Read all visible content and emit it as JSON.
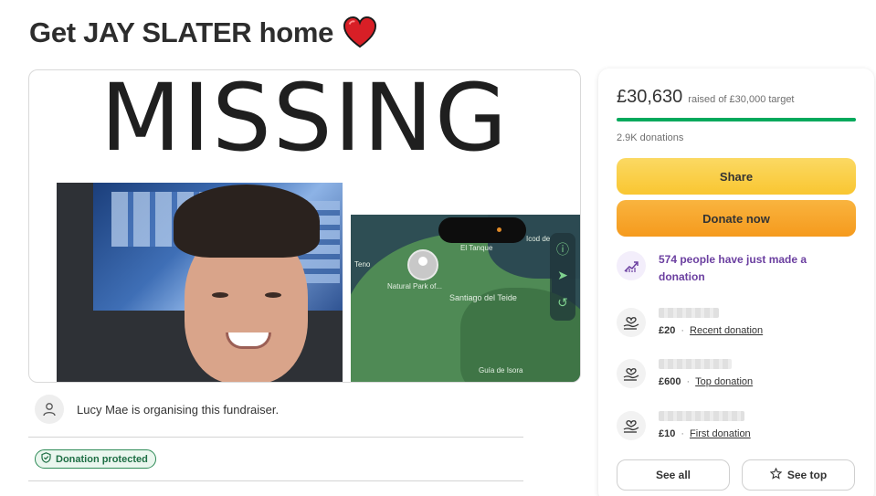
{
  "page": {
    "title": "Get JAY SLATER home"
  },
  "hero": {
    "headline": "MISSING",
    "map_labels": {
      "el_tanque": "El Tanque",
      "teno": "Teno",
      "natural_park": "Natural Park of...",
      "santiago": "Santiago del Teide",
      "guia": "Guía de Isora",
      "icod": "Icod de"
    }
  },
  "organiser": {
    "text": "Lucy Mae is organising this fundraiser."
  },
  "badge": {
    "label": "Donation protected"
  },
  "card": {
    "amount": "£30,630",
    "target_text": "raised of £30,000 target",
    "progress_fraction": 1.0,
    "donations": "2.9K donations",
    "share_label": "Share",
    "donate_label": "Donate now",
    "recent_people": "574 people have just made a donation",
    "donors": [
      {
        "amount": "£20",
        "type": "Recent donation"
      },
      {
        "amount": "£600",
        "type": "Top donation"
      },
      {
        "amount": "£10",
        "type": "First donation"
      }
    ],
    "see_all_label": "See all",
    "see_top_label": "See top"
  },
  "colors": {
    "progress": "#02a95c",
    "share": "#f9c631",
    "donate": "#f59a1d",
    "accent_purple": "#6b3fa0"
  },
  "icons": [
    "heart-icon",
    "user-icon",
    "shield-icon",
    "trend-up-icon",
    "donation-hand-icon",
    "star-icon"
  ]
}
